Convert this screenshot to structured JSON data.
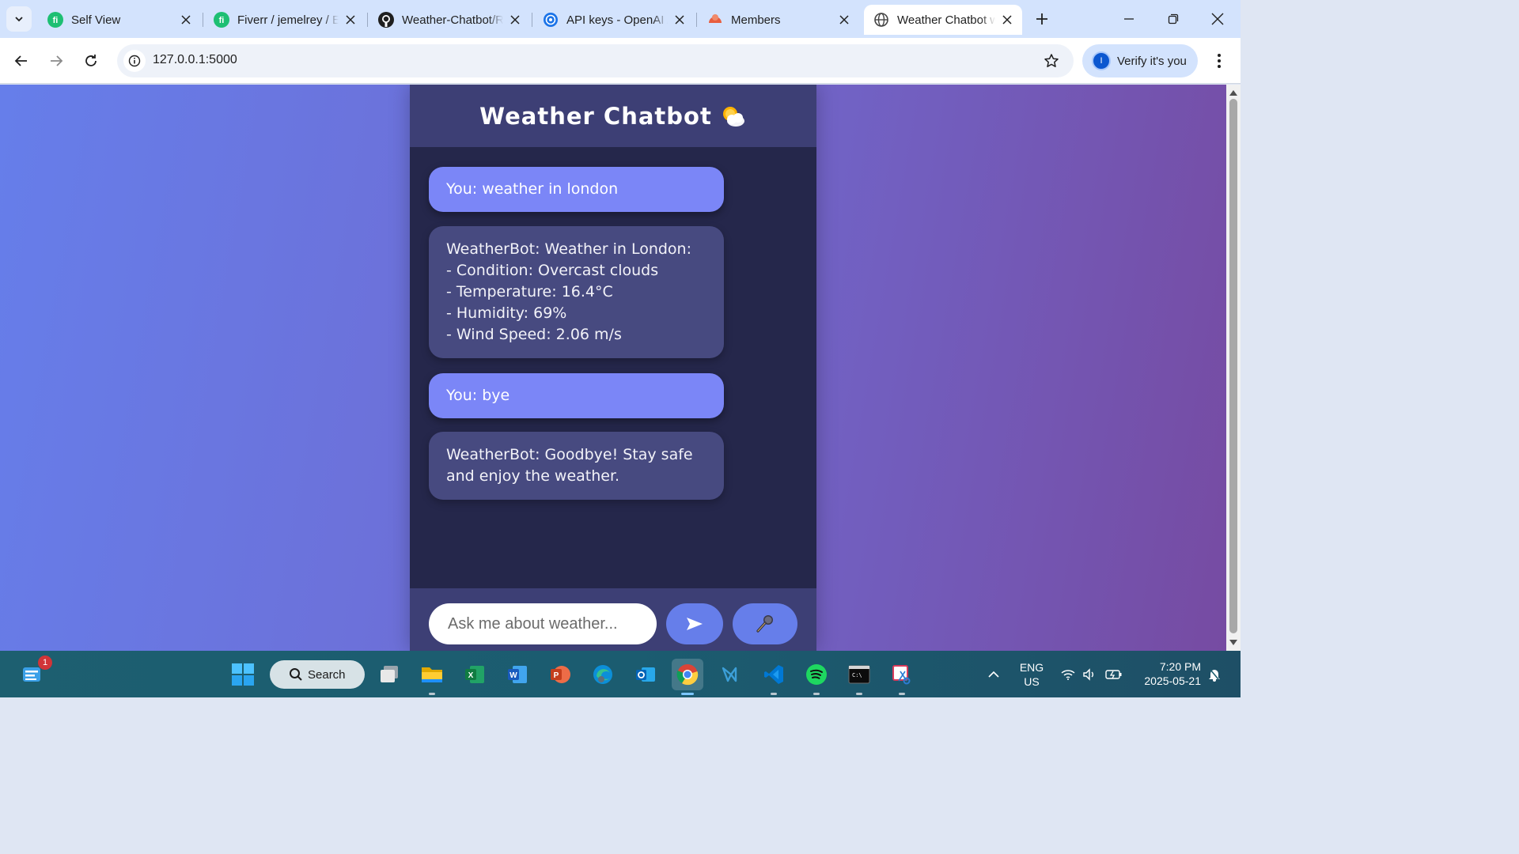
{
  "browser": {
    "tabs": [
      {
        "title": "Self View",
        "icon": "fiverr-icon"
      },
      {
        "title": "Fiverr / jemelrey / Edit",
        "icon": "fiverr-icon"
      },
      {
        "title": "Weather-Chatbot/README",
        "icon": "github-icon"
      },
      {
        "title": "API keys - OpenAI API",
        "icon": "openai-icon"
      },
      {
        "title": "Members",
        "icon": "members-icon"
      },
      {
        "title": "Weather Chatbot with Voice",
        "icon": "globe-icon",
        "active": true
      }
    ],
    "url": "127.0.0.1:5000",
    "verify_label": "Verify it's you",
    "profile_initial": "I"
  },
  "chat": {
    "title": "Weather Chatbot",
    "messages": [
      {
        "role": "user",
        "text": "You: weather in london"
      },
      {
        "role": "bot",
        "text": "WeatherBot: Weather in London:\n- Condition: Overcast clouds\n- Temperature: 16.4°C\n- Humidity: 69%\n- Wind Speed: 2.06 m/s"
      },
      {
        "role": "user",
        "text": "You: bye"
      },
      {
        "role": "bot",
        "text": "WeatherBot: Goodbye! Stay safe and enjoy the weather."
      }
    ],
    "input_placeholder": "Ask me about weather..."
  },
  "taskbar": {
    "search_label": "Search",
    "notification_count": "1",
    "language": "ENG",
    "region": "US",
    "time": "7:20 PM",
    "date": "2025-05-21"
  },
  "colors": {
    "gradient_start": "#667eea",
    "gradient_end": "#764ba2",
    "chat_bg": "#25274b",
    "header_bg": "#3d3f75",
    "user_bubble": "#7b86f7",
    "bot_bubble": "#474a80"
  }
}
